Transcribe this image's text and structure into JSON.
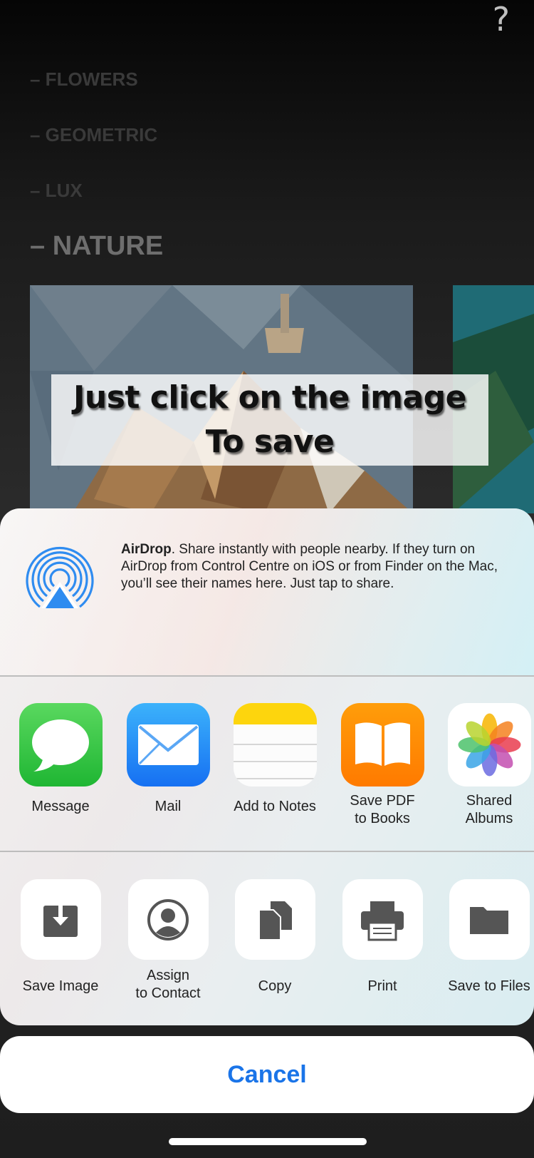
{
  "app": {
    "help_icon": "?",
    "categories": [
      {
        "label": "– FLOWERS"
      },
      {
        "label": "– GEOMETRIC"
      },
      {
        "label": "– LUX"
      },
      {
        "label": "– NATURE"
      }
    ],
    "active_category": "– NATURE",
    "overlay_lines": [
      "Just click on the image",
      "To save"
    ]
  },
  "share_sheet": {
    "airdrop": {
      "title": "AirDrop",
      "description": ". Share instantly with people nearby. If they turn on AirDrop from Control Centre on iOS or from Finder on the Mac, you’ll see their names here. Just tap to share."
    },
    "apps": [
      {
        "label": "Message",
        "icon": "message-icon"
      },
      {
        "label": "Mail",
        "icon": "mail-icon"
      },
      {
        "label": "Add to Notes",
        "icon": "notes-icon"
      },
      {
        "label": "Save PDF\nto Books",
        "icon": "books-icon"
      },
      {
        "label": "Shared\nAlbums",
        "icon": "photos-icon"
      }
    ],
    "actions": [
      {
        "label": "Save Image",
        "icon": "save-image-icon"
      },
      {
        "label": "Assign\nto Contact",
        "icon": "contact-icon"
      },
      {
        "label": "Copy",
        "icon": "copy-icon"
      },
      {
        "label": "Print",
        "icon": "print-icon"
      },
      {
        "label": "Save to Files",
        "icon": "folder-icon"
      }
    ],
    "cancel_label": "Cancel"
  },
  "colors": {
    "accent": "#1a74e8",
    "airdrop_blue": "#2f8cf0"
  }
}
